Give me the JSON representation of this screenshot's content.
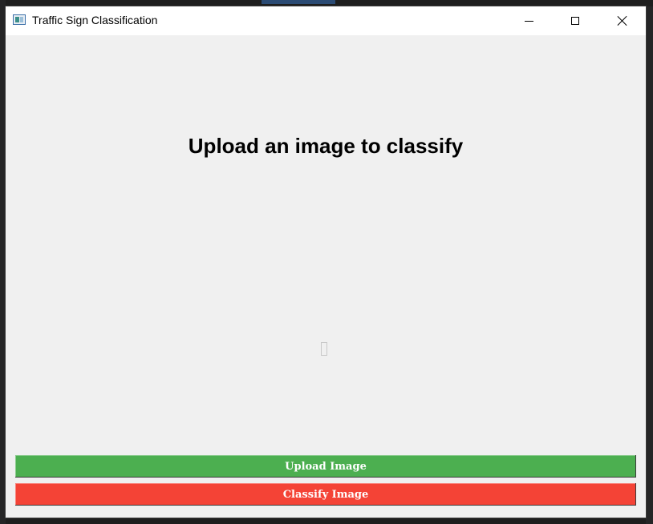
{
  "window": {
    "title": "Traffic Sign Classification",
    "icon": "app-window-icon",
    "controls": {
      "minimize": "minimize-icon",
      "maximize": "maximize-icon",
      "close": "close-icon"
    }
  },
  "main": {
    "heading": "Upload an image to classify",
    "image_placeholder": "image-display-area"
  },
  "buttons": {
    "upload": {
      "label": "Upload Image",
      "color": "#4caf50"
    },
    "classify": {
      "label": "Classify Image",
      "color": "#f44336"
    }
  },
  "colors": {
    "window_bg": "#f0f0f0",
    "titlebar_bg": "#ffffff",
    "desktop_bg": "#1e1e1e"
  }
}
